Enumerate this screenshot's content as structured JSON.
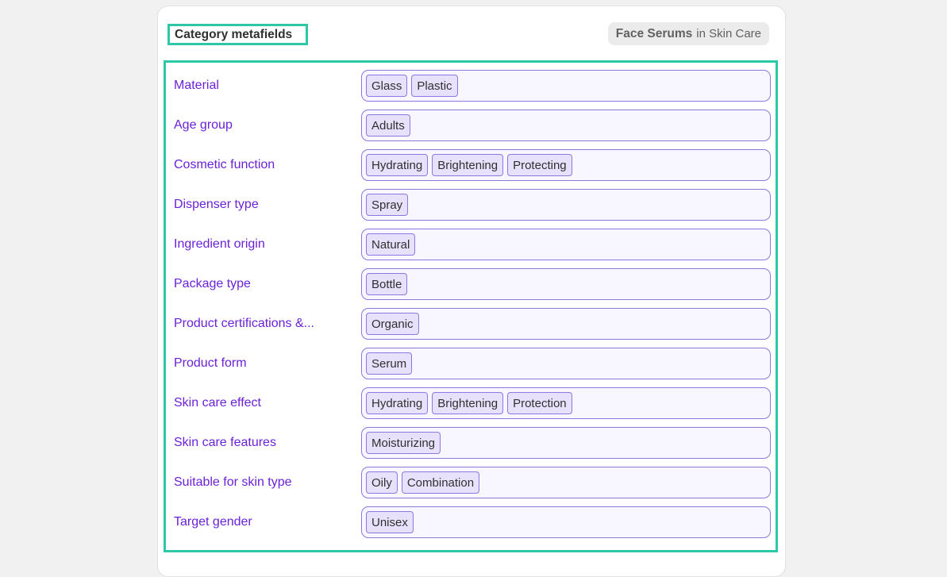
{
  "header": {
    "title": "Category metafields",
    "category_name": "Face Serums",
    "category_parent": "in Skin Care"
  },
  "fields": [
    {
      "label": "Material",
      "values": [
        "Glass",
        "Plastic"
      ]
    },
    {
      "label": "Age group",
      "values": [
        "Adults"
      ]
    },
    {
      "label": "Cosmetic function",
      "values": [
        "Hydrating",
        "Brightening",
        "Protecting"
      ]
    },
    {
      "label": "Dispenser type",
      "values": [
        "Spray"
      ]
    },
    {
      "label": "Ingredient origin",
      "values": [
        "Natural"
      ]
    },
    {
      "label": "Package type",
      "values": [
        "Bottle"
      ]
    },
    {
      "label": "Product certifications &...",
      "values": [
        "Organic"
      ]
    },
    {
      "label": "Product form",
      "values": [
        "Serum"
      ]
    },
    {
      "label": "Skin care effect",
      "values": [
        "Hydrating",
        "Brightening",
        "Protection"
      ]
    },
    {
      "label": "Skin care features",
      "values": [
        "Moisturizing"
      ]
    },
    {
      "label": "Suitable for skin type",
      "values": [
        "Oily",
        "Combination"
      ]
    },
    {
      "label": "Target gender",
      "values": [
        "Unisex"
      ]
    }
  ],
  "colors": {
    "highlight": "#2ec8a6",
    "label": "#6b21d8",
    "chip_border": "#8d78e2",
    "chip_background": "#e7e1fb"
  }
}
